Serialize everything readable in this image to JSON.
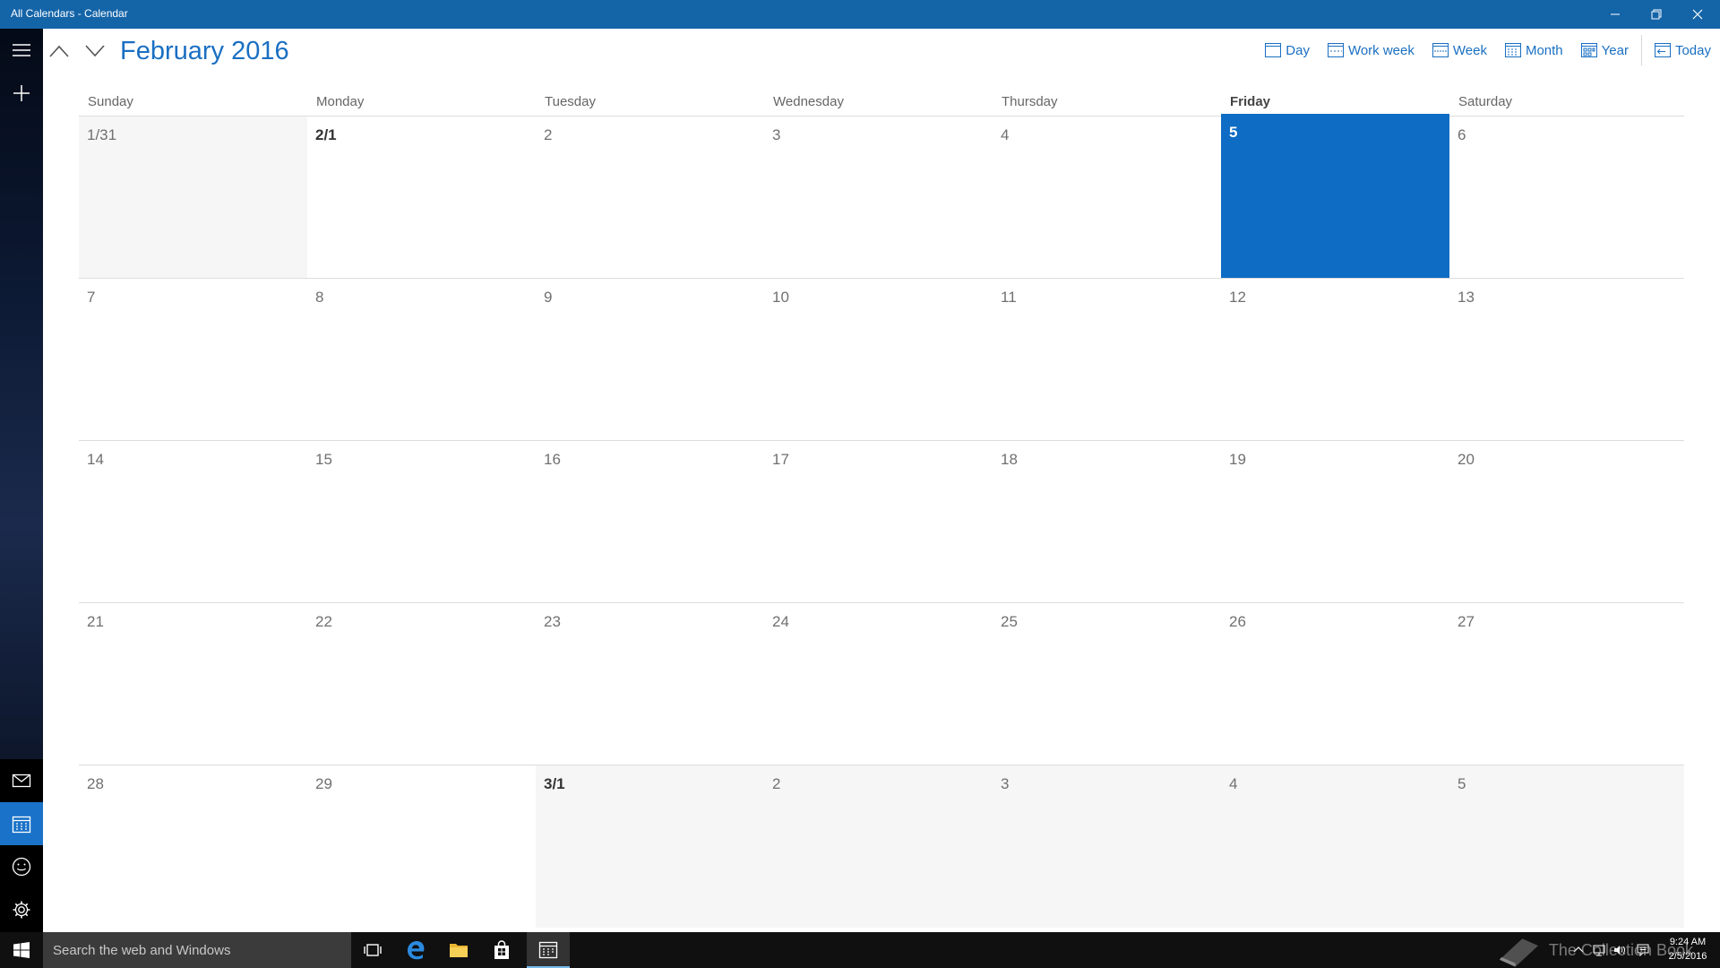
{
  "window": {
    "title": "All Calendars - Calendar"
  },
  "header": {
    "month_title": "February 2016",
    "views": [
      {
        "label": "Day",
        "icon": "day-view-icon"
      },
      {
        "label": "Work week",
        "icon": "work-week-view-icon"
      },
      {
        "label": "Week",
        "icon": "week-view-icon"
      },
      {
        "label": "Month",
        "icon": "month-view-icon"
      },
      {
        "label": "Year",
        "icon": "year-view-icon"
      },
      {
        "label": "Today",
        "icon": "today-icon"
      }
    ]
  },
  "calendar": {
    "day_names": [
      "Sunday",
      "Monday",
      "Tuesday",
      "Wednesday",
      "Thursday",
      "Friday",
      "Saturday"
    ],
    "today_column": 5,
    "weeks": [
      [
        {
          "label": "1/31",
          "other": true
        },
        {
          "label": "2/1",
          "first": true
        },
        {
          "label": "2"
        },
        {
          "label": "3"
        },
        {
          "label": "4"
        },
        {
          "label": "5",
          "today": true
        },
        {
          "label": "6"
        }
      ],
      [
        {
          "label": "7"
        },
        {
          "label": "8"
        },
        {
          "label": "9"
        },
        {
          "label": "10"
        },
        {
          "label": "11"
        },
        {
          "label": "12"
        },
        {
          "label": "13"
        }
      ],
      [
        {
          "label": "14"
        },
        {
          "label": "15"
        },
        {
          "label": "16"
        },
        {
          "label": "17"
        },
        {
          "label": "18"
        },
        {
          "label": "19"
        },
        {
          "label": "20"
        }
      ],
      [
        {
          "label": "21"
        },
        {
          "label": "22"
        },
        {
          "label": "23"
        },
        {
          "label": "24"
        },
        {
          "label": "25"
        },
        {
          "label": "26"
        },
        {
          "label": "27"
        }
      ],
      [
        {
          "label": "28"
        },
        {
          "label": "29"
        },
        {
          "label": "3/1",
          "other": true,
          "first": true
        },
        {
          "label": "2",
          "other": true
        },
        {
          "label": "3",
          "other": true
        },
        {
          "label": "4",
          "other": true
        },
        {
          "label": "5",
          "other": true
        }
      ]
    ]
  },
  "taskbar": {
    "search_placeholder": "Search the web and Windows",
    "watermark": "The Collection Book",
    "clock_time": "9:24 AM",
    "clock_date": "2/5/2016"
  },
  "colors": {
    "accent": "#0f6cc4",
    "titlebar": "#1464a8",
    "title_text": "#1a6fc2"
  }
}
